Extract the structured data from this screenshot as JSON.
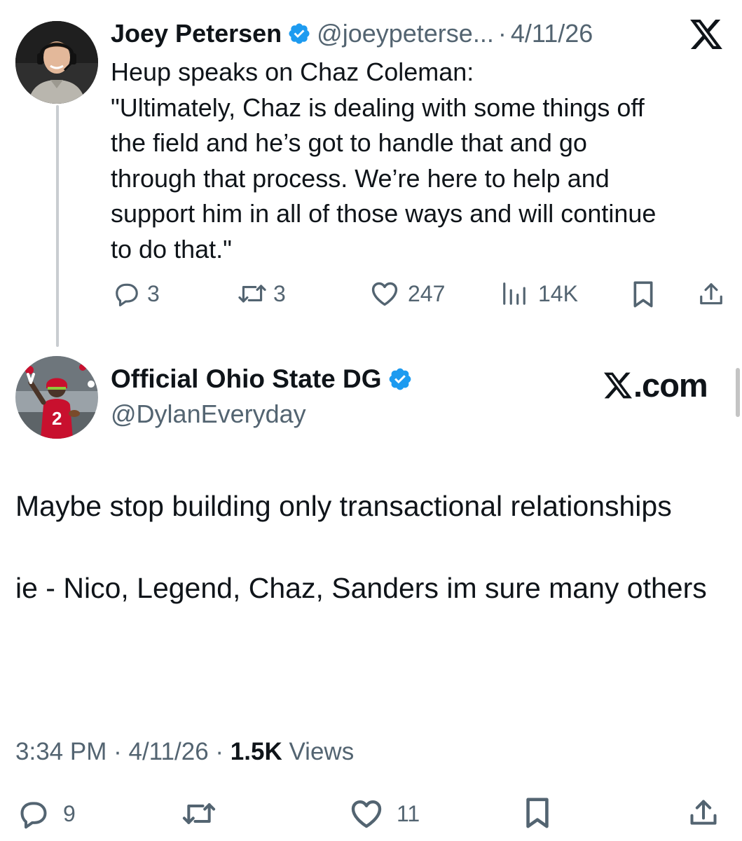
{
  "quoted_tweet": {
    "author_name": "Joey Petersen",
    "handle": "@joeypeterse...",
    "separator": "·",
    "date": "4/11/26",
    "text_lines": [
      "Heup speaks on Chaz Coleman:",
      "\"Ultimately, Chaz is dealing with some things off",
      "the field and he’s got to handle that and go",
      "through that process. We’re here to help and",
      "support him in all of those ways and will continue",
      "to do that.\""
    ],
    "actions": {
      "replies": "3",
      "reposts": "3",
      "likes": "247",
      "views": "14K"
    }
  },
  "reply_tweet": {
    "author_name": "Official Ohio State DG",
    "handle": "@DylanEveryday",
    "brand": ".com",
    "paragraphs": [
      "Maybe stop building only transactional relationships",
      "ie - Nico, Legend, Chaz, Sanders im sure many others"
    ],
    "meta": {
      "time": "3:34 PM",
      "date": "4/11/26",
      "views_count": "1.5K",
      "views_label": "Views"
    },
    "actions": {
      "replies": "9",
      "likes": "11"
    }
  },
  "colors": {
    "verified_blue": "#1d9bf0",
    "muted_text": "#536471",
    "primary_text": "#0f1419",
    "jersey_red": "#c8102e"
  },
  "icons": [
    "x-logo-icon",
    "verified-badge-icon",
    "reply-icon",
    "repost-icon",
    "like-icon",
    "views-icon",
    "bookmark-icon",
    "share-icon"
  ]
}
